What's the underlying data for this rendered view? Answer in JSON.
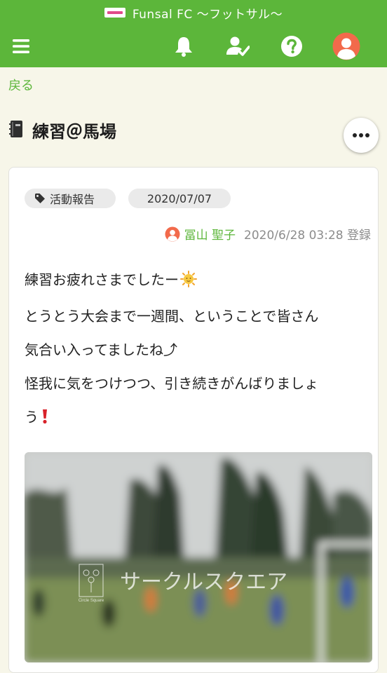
{
  "header": {
    "app_title": "Funsal FC 〜フットサル〜"
  },
  "nav": {
    "back_label": "戻る"
  },
  "page": {
    "title": "練習＠馬場"
  },
  "post": {
    "category_tag": "活動報告",
    "date_tag": "2020/07/07",
    "author_name": "冨山 聖子",
    "posted_at": "2020/6/28 03:28 登録",
    "lines": [
      "練習お疲れさまでしたー",
      "とうとう大会まで一週間、ということで皆さん",
      "気合い入ってましたね⤴",
      "怪我に気をつけつつ、引き続きがんばりましょ",
      "う"
    ],
    "watermark": "サークルスクエア",
    "watermark_small": "Circle Square"
  },
  "colors": {
    "brand_green": "#5cb63a",
    "avatar_orange": "#f26a4b",
    "background": "#f7f6e9"
  },
  "icons": [
    "menu-icon",
    "bell-icon",
    "person-check-icon",
    "help-icon",
    "user-avatar-icon",
    "notebook-icon",
    "more-icon",
    "tag-icon",
    "sun-emoji",
    "exclamation-emoji"
  ]
}
